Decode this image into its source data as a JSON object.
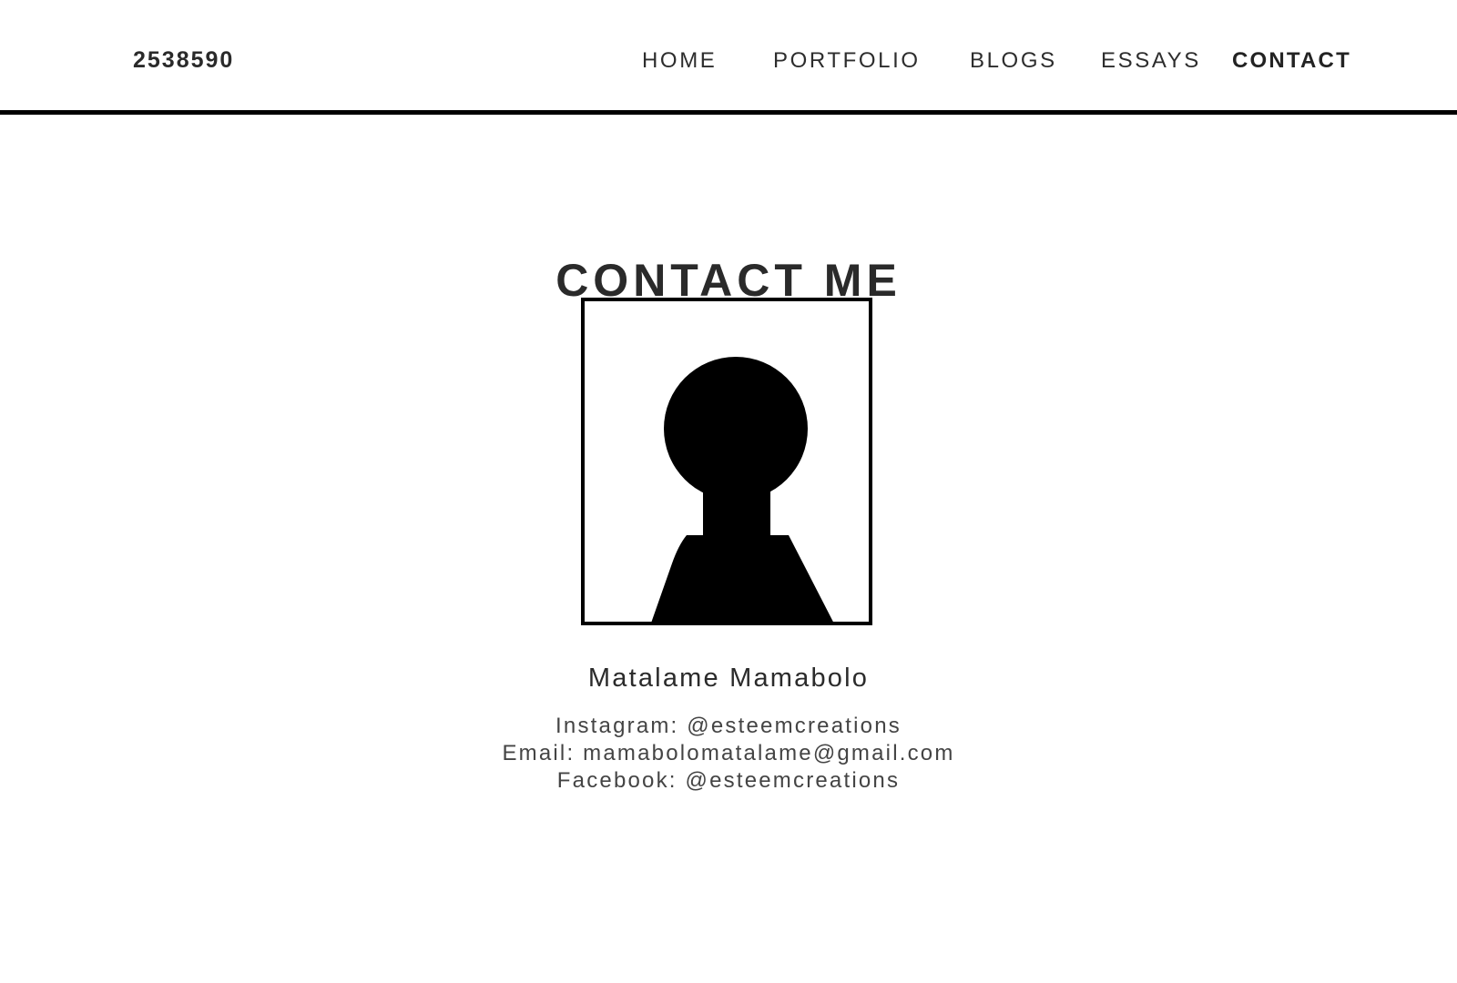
{
  "header": {
    "brand": "2538590",
    "nav": [
      {
        "label": "HOME",
        "active": false
      },
      {
        "label": "PORTFOLIO",
        "active": false
      },
      {
        "label": "BLOGS",
        "active": false
      },
      {
        "label": "ESSAYS",
        "active": false
      },
      {
        "label": "CONTACT",
        "active": true
      }
    ]
  },
  "main": {
    "title": "CONTACT ME",
    "portrait_icon": "person-silhouette-icon",
    "name": "Matalame Mamabolo",
    "contacts": [
      "Instagram: @esteemcreations",
      "Email: mamabolomatalame@gmail.com",
      "Facebook: @esteemcreations"
    ]
  },
  "colors": {
    "background": "#ffffff",
    "text": "#2b2b2b",
    "rule": "#000000",
    "silhouette": "#000000"
  }
}
